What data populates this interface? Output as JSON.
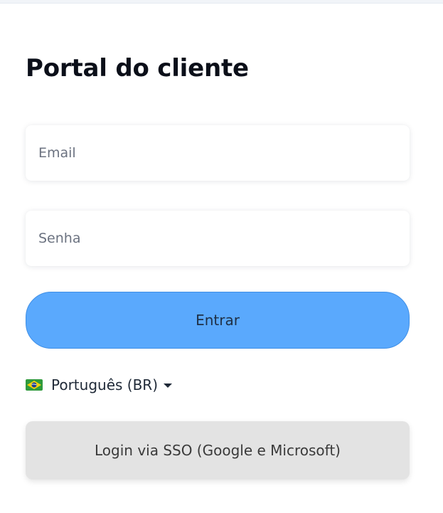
{
  "page": {
    "title": "Portal do cliente"
  },
  "form": {
    "email": {
      "placeholder": "Email",
      "value": ""
    },
    "password": {
      "placeholder": "Senha",
      "value": ""
    },
    "submit_label": "Entrar"
  },
  "language": {
    "selected": "Português (BR)",
    "flag_icon": "brazil-flag-icon"
  },
  "sso": {
    "label": "Login via SSO (Google e Microsoft)"
  },
  "colors": {
    "primary_button": "#5aa9fd",
    "sso_button": "#e3e3e3",
    "title_text": "#0b0f19"
  }
}
